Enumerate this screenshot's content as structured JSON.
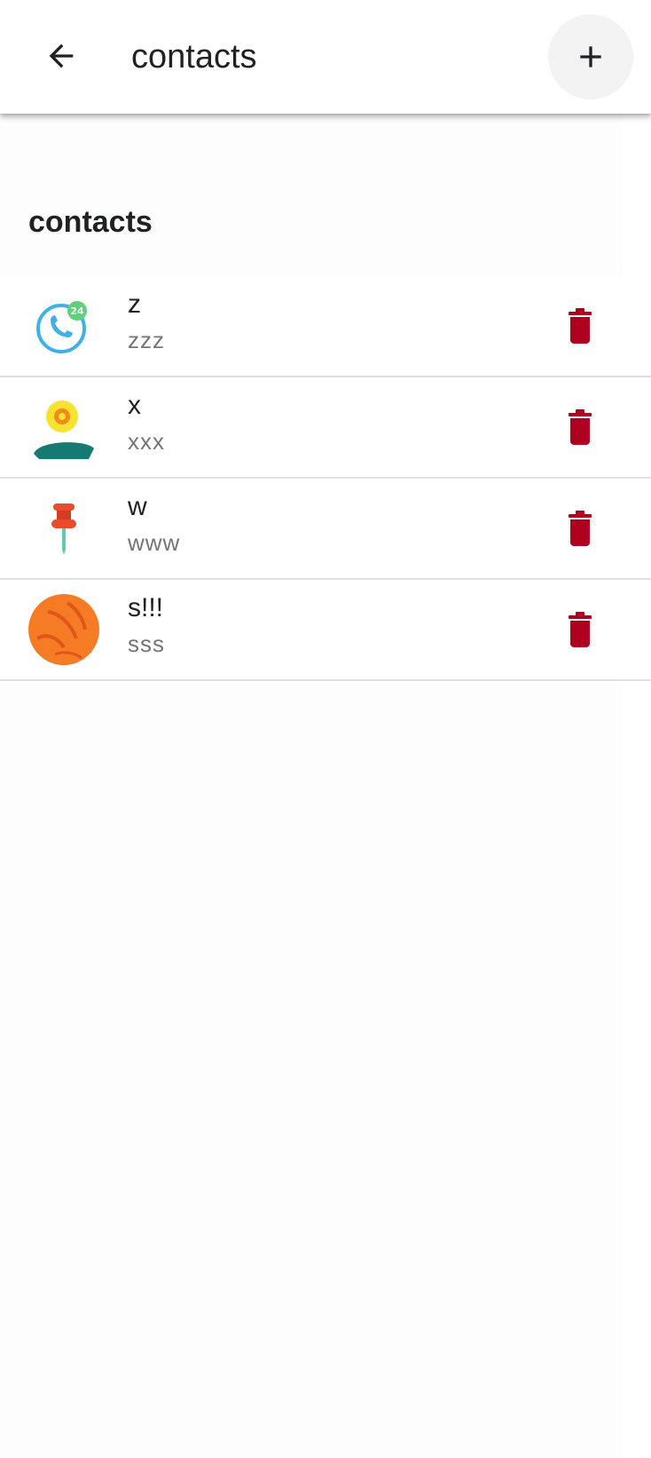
{
  "appbar": {
    "title": "contacts",
    "back_icon": "arrow-left-icon",
    "add_icon": "plus-icon"
  },
  "section": {
    "heading": "contacts"
  },
  "contacts": [
    {
      "name": "z",
      "detail": "zzz",
      "avatar": "phone-24-icon"
    },
    {
      "name": "x",
      "detail": "xxx",
      "avatar": "flower-island-icon"
    },
    {
      "name": "w",
      "detail": "www",
      "avatar": "pushpin-icon"
    },
    {
      "name": "s!!!",
      "detail": "sss",
      "avatar": "orange-ball-icon"
    }
  ],
  "colors": {
    "delete": "#b0001f",
    "divider": "#e0e0e0",
    "subtext": "#757575"
  }
}
